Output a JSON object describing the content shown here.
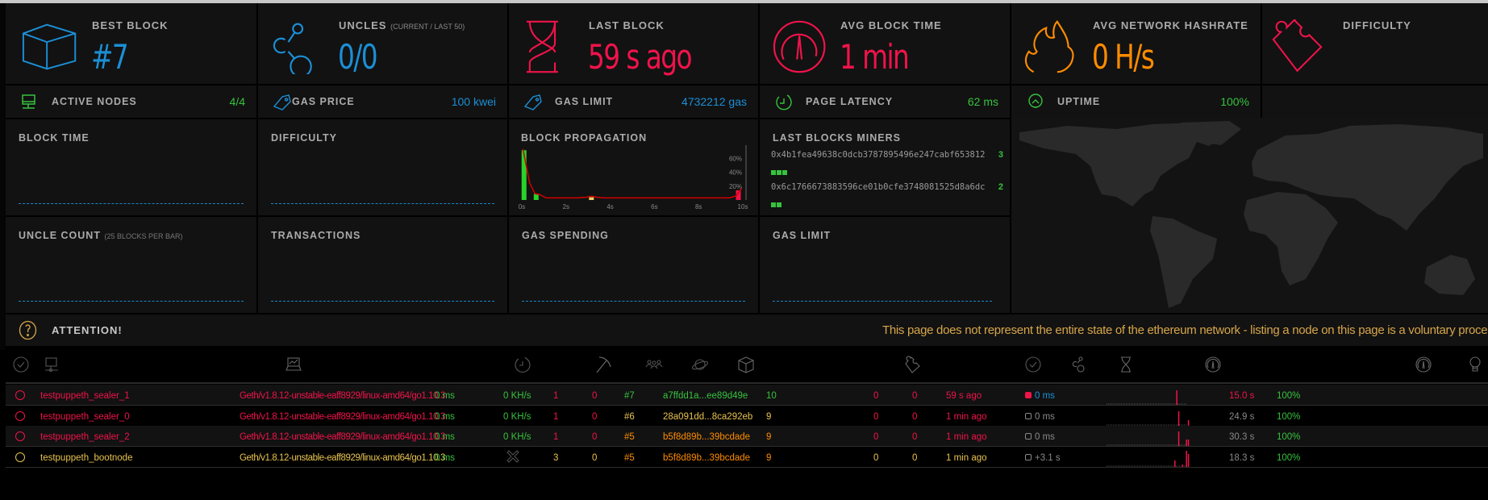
{
  "stats_top": [
    {
      "title": "BEST BLOCK",
      "subtitle": "",
      "value": "#7",
      "icon": "cube-icon",
      "color": "#1b8fd6"
    },
    {
      "title": "UNCLES",
      "subtitle": "(CURRENT / LAST 50)",
      "value": "0/0",
      "icon": "uncles-icon",
      "color": "#1b8fd6"
    },
    {
      "title": "LAST BLOCK",
      "subtitle": "",
      "value": "59 s ago",
      "icon": "hourglass-icon",
      "color": "#f0134a"
    },
    {
      "title": "AVG BLOCK TIME",
      "subtitle": "",
      "value": "1 min",
      "icon": "gauge-icon",
      "color": "#f0134a"
    },
    {
      "title": "AVG NETWORK HASHRATE",
      "subtitle": "",
      "value": "0 H/s",
      "icon": "flame-icon",
      "color": "#ff8c00"
    },
    {
      "title": "DIFFICULTY",
      "subtitle": "",
      "value": "",
      "icon": "puzzle-icon",
      "color": "#f0134a"
    }
  ],
  "stats_small": [
    {
      "title": "ACTIVE NODES",
      "value": "4/4",
      "icon": "monitor-icon",
      "color": "#36c23e"
    },
    {
      "title": "GAS PRICE",
      "value": "100 kwei",
      "icon": "tag-icon",
      "color": "#1b8fd6"
    },
    {
      "title": "GAS LIMIT",
      "value": "4732212 gas",
      "icon": "tag-icon",
      "color": "#1b8fd6"
    },
    {
      "title": "PAGE LATENCY",
      "value": "62 ms",
      "icon": "clock-icon",
      "color": "#36c23e"
    },
    {
      "title": "UPTIME",
      "value": "100%",
      "icon": "bulb-icon",
      "color": "#36c23e"
    }
  ],
  "charts": {
    "block_time": {
      "title": "BLOCK TIME"
    },
    "difficulty": {
      "title": "DIFFICULTY"
    },
    "block_propagation": {
      "title": "BLOCK PROPAGATION"
    },
    "last_blocks_miners": {
      "title": "LAST BLOCKS MINERS"
    },
    "uncle_count": {
      "title": "UNCLE COUNT",
      "subtitle": "(25 BLOCKS PER BAR)"
    },
    "transactions": {
      "title": "TRANSACTIONS"
    },
    "gas_spending": {
      "title": "GAS SPENDING"
    },
    "gas_limit": {
      "title": "GAS LIMIT"
    }
  },
  "chart_data": {
    "type": "bar",
    "title": "BLOCK PROPAGATION",
    "x_ticks": [
      "0s",
      "2s",
      "4s",
      "6s",
      "8s",
      "10s"
    ],
    "y_ticks": [
      "20%",
      "40%",
      "60%"
    ],
    "ylim": [
      0,
      70
    ],
    "xlim": [
      0,
      10
    ],
    "bars": [
      {
        "x": 0.1,
        "value": 72,
        "color": "#2ad22a"
      },
      {
        "x": 0.65,
        "value": 9,
        "color": "#2ad22a"
      },
      {
        "x": 3.15,
        "value": 4,
        "color": "#f0d060"
      },
      {
        "x": 9.8,
        "value": 14,
        "color": "#f0134a"
      }
    ],
    "curve": [
      [
        0.05,
        74
      ],
      [
        0.35,
        25
      ],
      [
        0.6,
        9
      ],
      [
        0.8,
        8
      ],
      [
        1.1,
        3
      ],
      [
        2.5,
        3
      ],
      [
        2.9,
        4
      ],
      [
        3.15,
        5.5
      ],
      [
        3.4,
        4
      ],
      [
        3.7,
        3
      ],
      [
        9.4,
        3
      ],
      [
        9.7,
        6
      ],
      [
        9.95,
        17
      ]
    ]
  },
  "miners": [
    {
      "address": "0x4b1fea49638c0dcb3787895496e247cabf653812",
      "count": "3",
      "blocks": 3
    },
    {
      "address": "0x6c1766673883596ce01b0cfe3748081525d8a6dc",
      "count": "2",
      "blocks": 2
    }
  ],
  "attention": {
    "title": "ATTENTION!",
    "message": "This page does not represent the entire state of the ethereum network - listing a node on this page is a voluntary proce"
  },
  "table_header_icons": [
    "check-circle-icon",
    "node-icon",
    "laptop-icon",
    "latency-clock-icon",
    "pickaxe-icon",
    "peers-icon",
    "planet-icon",
    "block-cube-icon",
    "puzzle-icon",
    "check-circle-icon",
    "uncles-icon",
    "hourglass-icon",
    "gauge-icon",
    "gauge-icon",
    "bulb-icon"
  ],
  "nodes": [
    {
      "name": "testpuppeth_sealer_1",
      "client": "Geth/v1.8.12-unstable-eaff8929/linux-amd64/go1.10.3",
      "latency": "0 ms",
      "hashrate": "0 KH/s",
      "peers": "1",
      "pending": "0",
      "block": "#7",
      "hash": "a7ffdd1a...ee89d49e",
      "difficulty": "10",
      "txs": "0",
      "uncles": "0",
      "last_block": "59 s ago",
      "propagation": "0 ms",
      "avg_time": "15.0 s",
      "uptime": "100%",
      "name_color": "#f0134a",
      "block_color": "#36c23e",
      "prop_color": "#1b8fd6",
      "prop_dot": "#f0134a",
      "avg_color": "#f0134a",
      "count_color": "#f0134a",
      "spark": [
        0,
        0,
        0,
        0,
        0,
        0,
        0,
        0,
        0,
        0,
        0,
        0,
        0,
        0,
        0,
        0,
        0,
        0,
        0,
        0,
        0,
        0,
        0,
        0,
        0,
        0,
        0,
        0,
        0,
        0,
        0,
        0,
        0,
        0,
        0,
        0,
        18,
        0,
        0,
        0,
        0,
        0,
        0
      ]
    },
    {
      "name": "testpuppeth_sealer_0",
      "client": "Geth/v1.8.12-unstable-eaff8929/linux-amd64/go1.10.3",
      "latency": "0 ms",
      "hashrate": "0 KH/s",
      "peers": "1",
      "pending": "0",
      "block": "#6",
      "hash": "28a091dd...8ca292eb",
      "difficulty": "9",
      "txs": "0",
      "uncles": "0",
      "last_block": "1 min ago",
      "propagation": "0 ms",
      "avg_time": "24.9 s",
      "uptime": "100%",
      "name_color": "#f0134a",
      "block_color": "#e8c34e",
      "prop_color": "#888888",
      "prop_dot": "",
      "avg_color": "#888888",
      "count_color": "#f0134a",
      "spark": [
        0,
        0,
        0,
        0,
        0,
        0,
        0,
        0,
        0,
        0,
        0,
        0,
        0,
        0,
        0,
        0,
        0,
        0,
        0,
        0,
        0,
        0,
        0,
        0,
        0,
        0,
        0,
        0,
        0,
        0,
        0,
        0,
        0,
        0,
        0,
        0,
        0,
        18,
        0,
        0,
        0,
        0,
        7
      ]
    },
    {
      "name": "testpuppeth_sealer_2",
      "client": "Geth/v1.8.12-unstable-eaff8929/linux-amd64/go1.10.3",
      "latency": "0 ms",
      "hashrate": "0 KH/s",
      "peers": "1",
      "pending": "0",
      "block": "#5",
      "hash": "b5f8d89b...39bcdade",
      "difficulty": "9",
      "txs": "0",
      "uncles": "0",
      "last_block": "1 min ago",
      "propagation": "0 ms",
      "avg_time": "30.3 s",
      "uptime": "100%",
      "name_color": "#f0134a",
      "block_color": "#ff8c00",
      "prop_color": "#888888",
      "prop_dot": "",
      "avg_color": "#888888",
      "count_color": "#f0134a",
      "spark": [
        0,
        0,
        0,
        0,
        0,
        0,
        0,
        0,
        0,
        0,
        0,
        0,
        0,
        0,
        0,
        0,
        0,
        0,
        0,
        0,
        0,
        0,
        0,
        0,
        0,
        0,
        0,
        0,
        0,
        0,
        0,
        0,
        0,
        0,
        0,
        0,
        0,
        18,
        0,
        0,
        0,
        8,
        8
      ]
    },
    {
      "name": "testpuppeth_bootnode",
      "client": "Geth/v1.8.12-unstable-eaff8929/linux-amd64/go1.10.3",
      "latency": "0 ms",
      "hashrate": "",
      "peers": "3",
      "pending": "0",
      "block": "#5",
      "hash": "b5f8d89b...39bcdade",
      "difficulty": "9",
      "txs": "0",
      "uncles": "0",
      "last_block": "1 min ago",
      "propagation": "+3.1 s",
      "avg_time": "18.3 s",
      "uptime": "100%",
      "name_color": "#e8c34e",
      "block_color": "#ff8c00",
      "prop_color": "#888888",
      "prop_dot": "",
      "avg_color": "#888888",
      "count_color": "#e8c34e",
      "spark": [
        0,
        0,
        0,
        0,
        0,
        0,
        0,
        0,
        0,
        0,
        0,
        0,
        0,
        0,
        0,
        0,
        0,
        0,
        0,
        0,
        0,
        0,
        0,
        0,
        0,
        0,
        0,
        0,
        0,
        0,
        0,
        0,
        0,
        0,
        0,
        8,
        0,
        0,
        0,
        3,
        0,
        20,
        16
      ]
    }
  ]
}
